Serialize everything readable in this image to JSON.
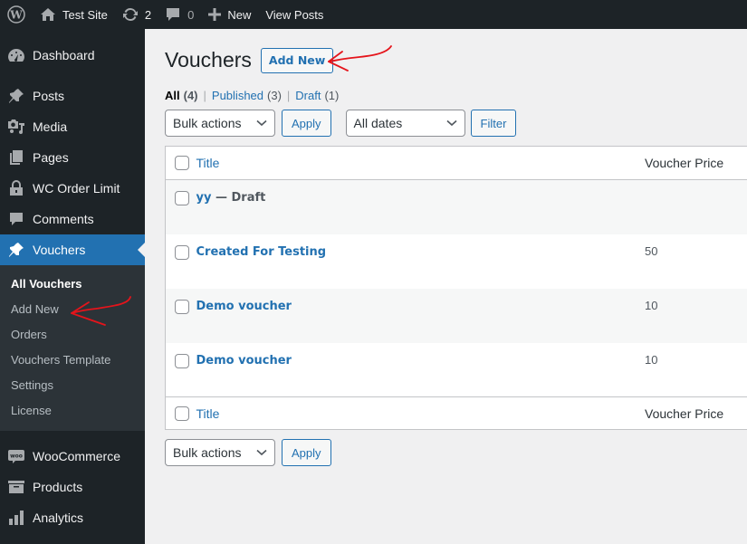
{
  "adminbar": {
    "site_name": "Test Site",
    "updates_count": "2",
    "comments_count": "0",
    "new_label": "New",
    "view_posts_label": "View Posts"
  },
  "sidebar": {
    "items": [
      {
        "label": "Dashboard",
        "icon": "dashboard-icon"
      },
      {
        "label": "Posts",
        "icon": "pin-icon"
      },
      {
        "label": "Media",
        "icon": "media-icon"
      },
      {
        "label": "Pages",
        "icon": "pages-icon"
      },
      {
        "label": "WC Order Limit",
        "icon": "lock-icon"
      },
      {
        "label": "Comments",
        "icon": "comment-icon"
      },
      {
        "label": "Vouchers",
        "icon": "pin-icon",
        "active": true
      }
    ],
    "submenu": [
      {
        "label": "All Vouchers",
        "current": true
      },
      {
        "label": "Add New"
      },
      {
        "label": "Orders"
      },
      {
        "label": "Vouchers Template"
      },
      {
        "label": "Settings"
      },
      {
        "label": "License"
      }
    ],
    "items_after": [
      {
        "label": "WooCommerce",
        "icon": "woo-icon"
      },
      {
        "label": "Products",
        "icon": "archive-icon"
      },
      {
        "label": "Analytics",
        "icon": "chart-bar-icon"
      }
    ]
  },
  "main": {
    "title": "Vouchers",
    "add_new_label": "Add New",
    "filters": [
      {
        "label": "All",
        "count": "(4)",
        "current": true
      },
      {
        "label": "Published",
        "count": "(3)"
      },
      {
        "label": "Draft",
        "count": "(1)"
      }
    ],
    "bulk_actions_label": "Bulk actions",
    "apply_label": "Apply",
    "dates_label": "All dates",
    "filter_label": "Filter",
    "columns": {
      "title": "Title",
      "price": "Voucher Price"
    },
    "rows": [
      {
        "title": "yy",
        "state": " — Draft",
        "price": ""
      },
      {
        "title": "Created For Testing",
        "state": "",
        "price": "50"
      },
      {
        "title": "Demo voucher",
        "state": "",
        "price": "10"
      },
      {
        "title": "Demo voucher",
        "state": "",
        "price": "10"
      }
    ]
  },
  "annotation_color": "#e5141b"
}
